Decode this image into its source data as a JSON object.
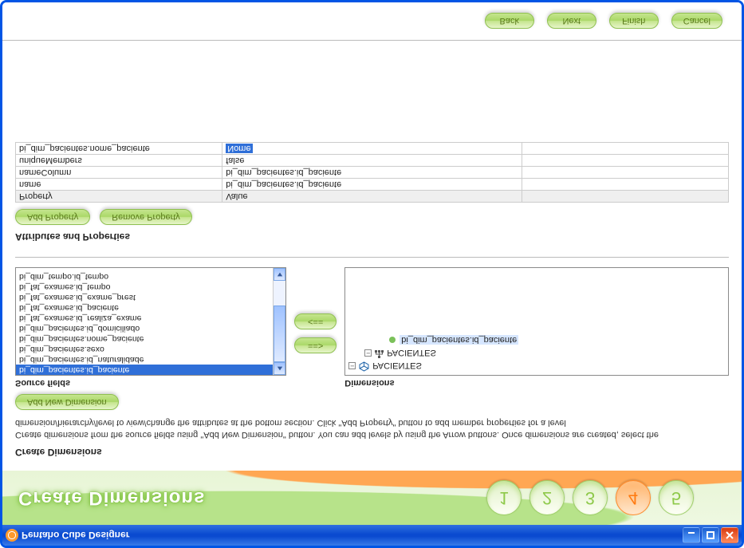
{
  "window": {
    "title": "Pentaho Cube Designer"
  },
  "banner": {
    "title": "Create Dimensions",
    "steps": [
      "1",
      "2",
      "3",
      "4",
      "5"
    ],
    "active_step_index": 3
  },
  "section1": {
    "heading": "Create Dimensions",
    "help": "Create dimensions from the source fields using \"Add New Dimension\" button. You can add levels by using the Arrow buttons. Once dimensions are created, select the dimension/hierarchy/level to view/change the attributes at the bottom section. Click \"Add Property\" button to add member properties for a level",
    "add_new_dimension": "Add New Dimension"
  },
  "source": {
    "label": "Source fields",
    "items": [
      "bi_dim_pacientes.id_paciente",
      "bi_dim_pacientes.id_naturalidade",
      "bi_dim_pacientes.sexo",
      "bi_dim_pacientes.nome_paciente",
      "bi_dim_pacientes.id_domiciliado",
      "bi_fat_exames.id_realiza_exame",
      "bi_fat_exames.id_paciente",
      "bi_fat_exames.id_exame_prest",
      "bi_fat_exames.id_tempo",
      "bi_dim_tempo.id_tempo"
    ],
    "selected_index": 0
  },
  "arrows": {
    "right": "==>",
    "left": "<=="
  },
  "dimensions": {
    "label": "Dimensions",
    "root": {
      "name": "PACIENTES",
      "expanded": true
    },
    "hierarchy": {
      "name": "PACIENTES",
      "expanded": true
    },
    "level": {
      "name": "bi_dim_pacientes.id_paciente"
    }
  },
  "section2": {
    "heading": "Attributes and Properties",
    "add_property": "Add Property",
    "remove_property": "Remove Property"
  },
  "props": {
    "headers": [
      "Property",
      "Value"
    ],
    "rows": [
      {
        "prop": "name",
        "value": "bi_dim_pacientes.id_paciente"
      },
      {
        "prop": "nameColumn",
        "value": "bi_dim_pacientes.id_paciente"
      },
      {
        "prop": "uniqueMembers",
        "value": "false"
      },
      {
        "prop": "bi_dim_pacientes.nome_paciente",
        "value": "Nome",
        "value_selected": true
      }
    ]
  },
  "footer": {
    "back": "Back",
    "next": "Next",
    "finish": "Finish",
    "cancel": "Cancel"
  }
}
